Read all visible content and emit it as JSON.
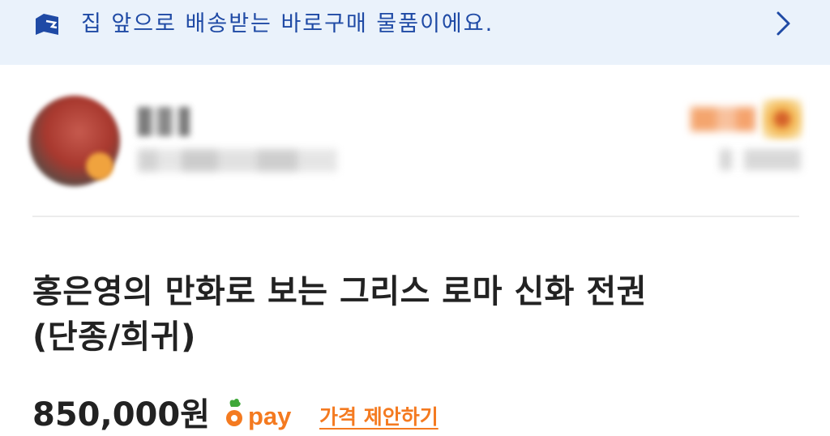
{
  "banner": {
    "text": "집 앞으로 배송받는 바로구매 물품이에요.",
    "icon": "delivery-box-icon",
    "chevron": "chevron-right-icon",
    "text_color": "#1f4aa5",
    "background": "#eaf2fb"
  },
  "product": {
    "title_line1": "홍은영의 만화로 보는 그리스 로마 신화 전권",
    "title_line2": "(단종/희귀)",
    "price": "850,000원",
    "pay_label": "pay",
    "offer_label": "가격 제안하기",
    "accent_color": "#f47a20"
  }
}
